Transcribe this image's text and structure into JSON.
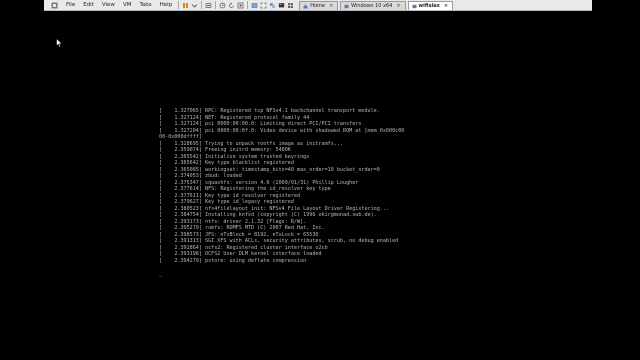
{
  "menu": {
    "items": [
      "File",
      "Edit",
      "View",
      "VM",
      "Tabs",
      "Help"
    ]
  },
  "tabs": [
    {
      "label": "Home",
      "active": false
    },
    {
      "label": "Windows 10 x64",
      "active": false
    },
    {
      "label": "wifislax",
      "active": true
    }
  ],
  "icons": {
    "app": "vmware-logo-icon",
    "pause": "pause-icon",
    "toolbar": [
      "send-ctrl-alt-del-icon",
      "snapshot-icon",
      "revert-snapshot-icon",
      "snapshot-manager-icon",
      "fit-guest-icon",
      "fullscreen-icon",
      "unity-icon",
      "console-view-icon",
      "thumbnail-icon"
    ],
    "tab_close": "close-icon"
  },
  "colors": {
    "console_text": "#b8b8b8",
    "background": "#000000",
    "toolbar_bg": "#e9e9e9",
    "active_tab_bg": "#ffffff"
  },
  "console": {
    "lines": [
      "[    1.327065] RPC: Registered tcp NFSv4.1 backchannel transport module.",
      "[    1.327124] NET: Registered protocol family 44",
      "[    1.327124] pci 0000:00:00.0: Limiting direct PCI/PCI transfers",
      "[    1.327204] pci 0000:00:0f.0: Video device with shadowed ROM at [mem 0x000c00",
      "00-0x000dffff]",
      "[    1.328695] Trying to unpack rootfs image as initramfs...",
      "[    2.359074] Freeing initrd memory: 5480K",
      "[    2.365542] Initialise system trusted keyrings",
      "[    2.365642] Key type blacklist registered",
      "[    2.365085] workingset: timestamp_bits=40 max_order=19 bucket_order=0",
      "[    2.374053] zbud: loaded",
      "[    2.375347] squashfs: version 4.0 (2009/01/31) Phillip Lougher",
      "[    2.377614] NFS: Registering the id_resolver key type",
      "[    2.377611] Key type id_resolver registered",
      "[    2.379627] Key type id_legacy registered",
      "[    2.380523] nfs4filelayout_init: NFSv4 File Layout Driver Registering...",
      "[    2.384754] Installing knfsd (copyright (C) 1996 okir@monad.swb.de).",
      "[    2.393173] ntfs: driver 2.1.32 [Flags: R/W].",
      "[    2.395279] romfs: ROMFS MTD (C) 2007 Red Hat, Inc.",
      "[    2.398573] JFS: nTxBlock = 8192, nTxLock = 65536",
      "[    2.391313] SGI XFS with ACLs, security attributes, scrub, no debug enabled",
      "[    2.392864] ocfs2: Registered cluster interface o2cb",
      "[    2.393198] OCFS2 User DLM kernel interface loaded",
      "[    2.394279] pstore: using deflate compression",
      "",
      "_"
    ]
  }
}
